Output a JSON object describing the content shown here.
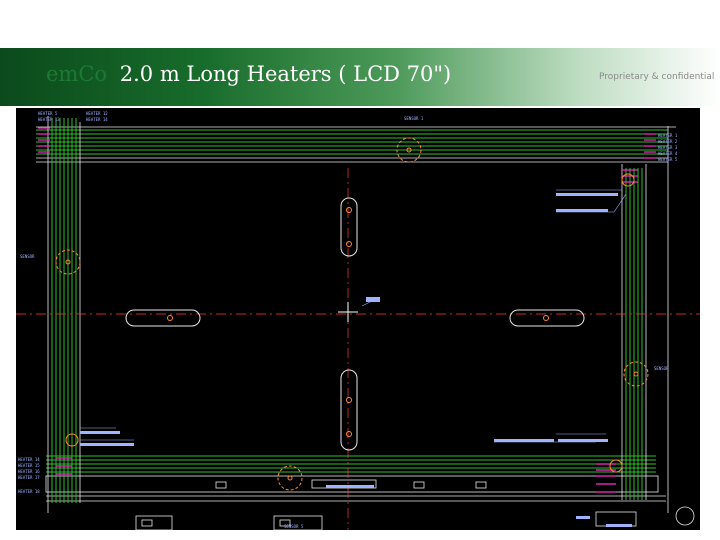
{
  "header": {
    "brand": "emCo",
    "title": "2.0 m Long Heaters ( LCD 70\")",
    "confidential": "Proprietary & confidential"
  },
  "drawing": {
    "top_left_labels": [
      "HEATER 5",
      "HEATER 12",
      "HEATER 13",
      "HEATER 14"
    ],
    "sensor_top": "SENSOR 1",
    "sensor_bottom": "SENSOR 5",
    "sensor_left": "SENSOR",
    "sensor_right": "SENSOR",
    "heater_right": [
      "HEATER 1",
      "HEATER 2",
      "HEATER 3",
      "HEATER 4",
      "HEATER 5"
    ],
    "heater_left": [
      "HEATER 14",
      "HEATER 15",
      "HEATER 16",
      "HEATER 17",
      "HEATER 18"
    ],
    "colors": {
      "background": "#000000",
      "heater_line": "#2fbf2f",
      "frame_line": "#e6e6e6",
      "magenta": "#ff2fd0",
      "orange": "#ff8a2a",
      "center_red": "#ff3b3b",
      "annotation": "#9fb3ff"
    }
  }
}
